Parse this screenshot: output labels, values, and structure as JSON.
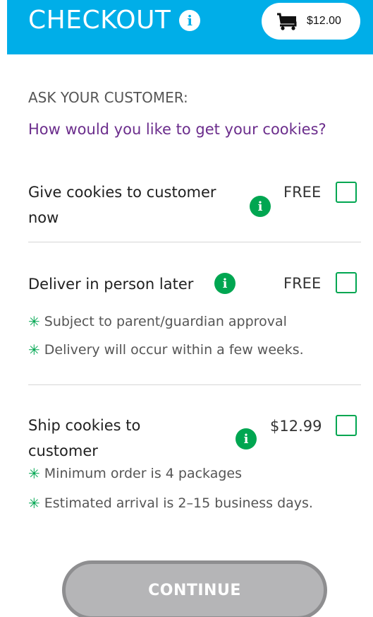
{
  "header": {
    "title": "CHECKOUT",
    "info_icon": "i",
    "cart_icon": "shopping-cart-icon",
    "cart_total": "$12.00"
  },
  "prompt": {
    "label": "ASK YOUR CUSTOMER:",
    "question": "How would you like to get your cookies?"
  },
  "options": [
    {
      "title_line1": "Give cookies to customer",
      "title_line2": "now",
      "price": "FREE",
      "notes": []
    },
    {
      "title_line1": "Deliver in person later",
      "price": "FREE",
      "notes": [
        "Subject to parent/guardian approval",
        "Delivery will occur within a few weeks."
      ]
    },
    {
      "title_line1": "Ship cookies to",
      "title_line2": "customer",
      "price": "$12.99",
      "notes": [
        "Minimum order is 4 packages",
        "Estimated arrival is 2–15 business days."
      ]
    }
  ],
  "note_bullet": "✳",
  "continue_label": "CONTINUE",
  "colors": {
    "header": "#00aee8",
    "accent_green": "#00a651",
    "question_purple": "#6b2d8c",
    "button_disabled": "#b5b5b7"
  }
}
